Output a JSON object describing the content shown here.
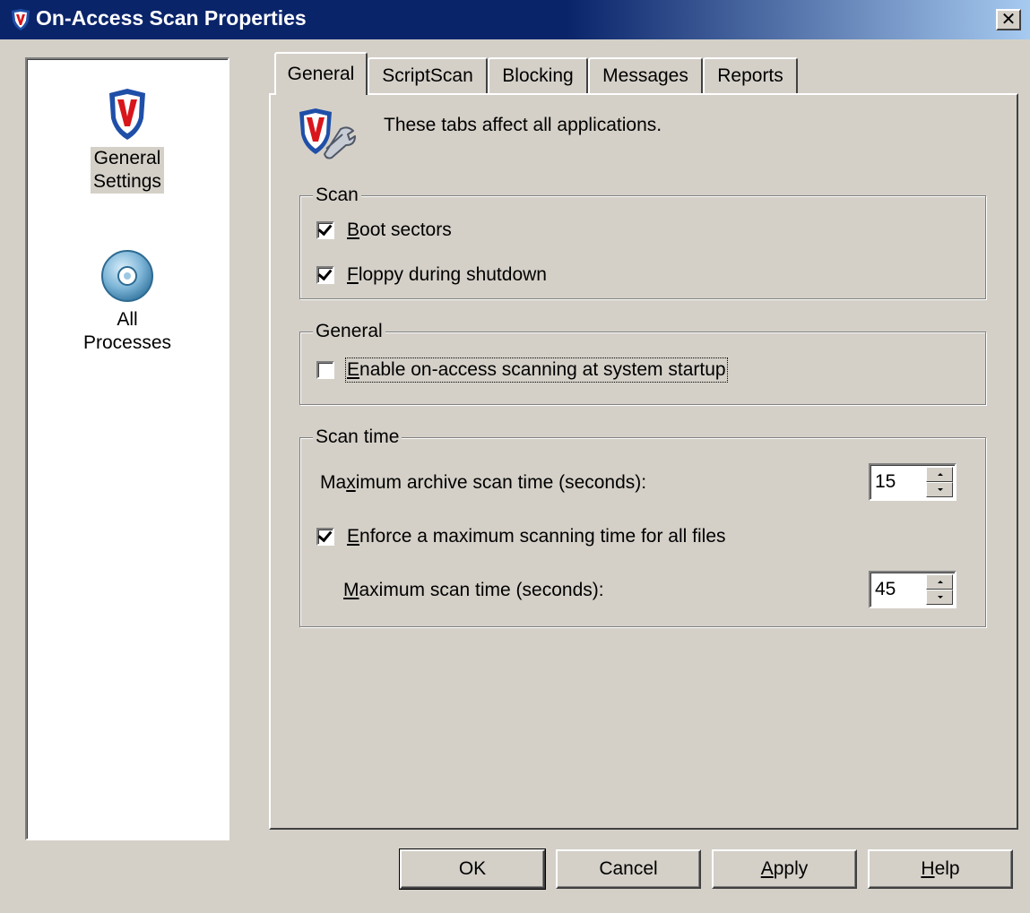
{
  "window": {
    "title": "On-Access Scan Properties",
    "close_glyph": "✕"
  },
  "nav": {
    "items": [
      {
        "line1": "General",
        "line2": "Settings",
        "icon": "shield-v-icon",
        "selected": true
      },
      {
        "line1": "All",
        "line2": "Processes",
        "icon": "cd-disc-icon",
        "selected": false
      }
    ]
  },
  "tabs": [
    {
      "label": "General",
      "active": true
    },
    {
      "label": "ScriptScan",
      "active": false
    },
    {
      "label": "Blocking",
      "active": false
    },
    {
      "label": "Messages",
      "active": false
    },
    {
      "label": "Reports",
      "active": false
    }
  ],
  "general_tab": {
    "info_text": "These tabs affect all applications.",
    "scan_group": {
      "title": "Scan",
      "boot_sectors": {
        "mn": "B",
        "rest": "oot sectors",
        "checked": true
      },
      "floppy": {
        "mn": "F",
        "rest": "loppy during shutdown",
        "checked": true
      }
    },
    "general_group": {
      "title": "General",
      "enable_startup": {
        "pre": "",
        "mn": "E",
        "rest": "nable on-access scanning at system startup",
        "checked": false
      }
    },
    "scantime_group": {
      "title": "Scan time",
      "archive_label": {
        "pre": "Ma",
        "mn": "x",
        "rest": "imum archive scan time (seconds):"
      },
      "archive_value": "15",
      "enforce": {
        "mn": "E",
        "rest": "nforce a maximum scanning time for all files",
        "checked": true
      },
      "max_label": {
        "pre": "",
        "mn": "M",
        "rest": "aximum scan time (seconds):"
      },
      "max_value": "45"
    }
  },
  "buttons": {
    "ok": "OK",
    "cancel": "Cancel",
    "apply": {
      "mn": "A",
      "rest": "pply"
    },
    "help": {
      "mn": "H",
      "rest": "elp"
    }
  },
  "colors": {
    "titlebar_start": "#0a246a",
    "titlebar_end": "#a6caf0",
    "face": "#d4d0c8",
    "shield_blue": "#1f4fa8",
    "shield_red": "#d8161b"
  }
}
